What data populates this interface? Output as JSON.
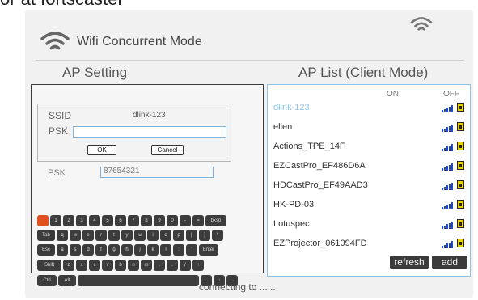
{
  "top_cut_text": "or at fortscaster",
  "header": {
    "title": "Wifi Concurrent Mode",
    "icon": "wifi-icon"
  },
  "ap_setting": {
    "title": "AP Setting",
    "dialog": {
      "ssid_label": "SSID",
      "ssid_value": "dlink-123",
      "psk_label": "PSK",
      "psk_value": "",
      "ok_label": "OK",
      "cancel_label": "Cancel"
    },
    "behind_label": "PSK",
    "behind_value": "87654321"
  },
  "keyboard": {
    "row1": [
      "",
      "1",
      "2",
      "3",
      "4",
      "5",
      "6",
      "7",
      "8",
      "9",
      "0",
      "-",
      "=",
      "bksp"
    ],
    "row2": [
      "Tab",
      "q",
      "w",
      "e",
      "r",
      "t",
      "y",
      "u",
      "i",
      "o",
      "p",
      "[",
      "]",
      "\\"
    ],
    "row3": [
      "Esc",
      "a",
      "s",
      "d",
      "f",
      "g",
      "h",
      "j",
      "k",
      "l",
      ";",
      "'",
      "Enter"
    ],
    "row4": [
      "Shift",
      "z",
      "x",
      "c",
      "v",
      "b",
      "n",
      "m",
      ",",
      ".",
      "/",
      "↑"
    ],
    "row5": [
      "Ctrl",
      "Alt",
      "",
      "←",
      "↓",
      "→"
    ]
  },
  "ap_list": {
    "title": "AP List (Client Mode)",
    "on_label": "ON",
    "off_label": "OFF",
    "networks": [
      {
        "name": "dlink-123",
        "signal_bars": 5,
        "locked": true
      },
      {
        "name": "elien",
        "signal_bars": 5,
        "locked": true
      },
      {
        "name": "Actions_TPE_14F",
        "signal_bars": 5,
        "locked": true
      },
      {
        "name": "EZCastPro_EF486D6A",
        "signal_bars": 5,
        "locked": true
      },
      {
        "name": "HDCastPro_EF49AAD3",
        "signal_bars": 5,
        "locked": true
      },
      {
        "name": "HK-PD-03",
        "signal_bars": 5,
        "locked": true
      },
      {
        "name": "Lotuspec",
        "signal_bars": 5,
        "locked": true
      },
      {
        "name": "EZProjector_061094FD",
        "signal_bars": 5,
        "locked": true
      }
    ],
    "refresh_label": "refresh",
    "add_label": "add"
  },
  "status_text": "connecting to ......",
  "colors": {
    "accent": "#8fc3e8",
    "key_bg": "#3c3c3c",
    "key_orange": "#e0501c",
    "signal": "#1f49c7",
    "lock": "#e9d100"
  }
}
